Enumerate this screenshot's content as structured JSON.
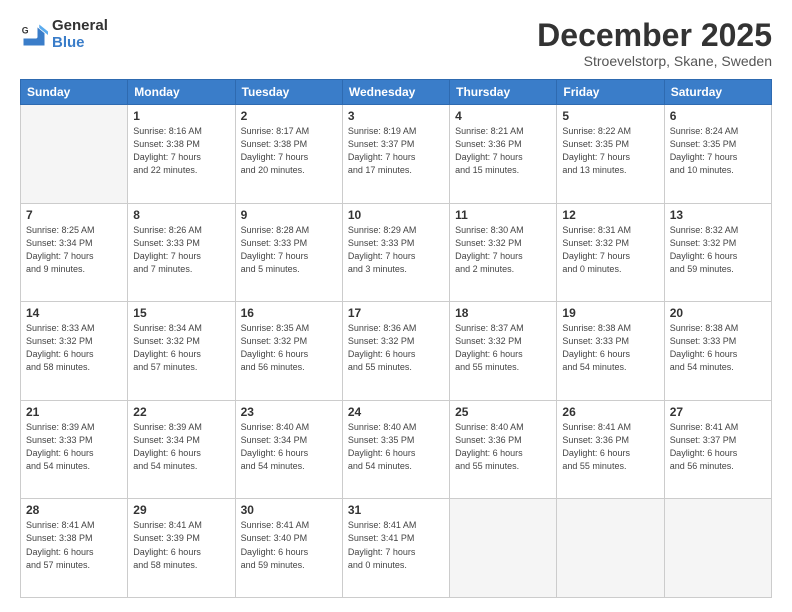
{
  "logo": {
    "general": "General",
    "blue": "Blue"
  },
  "header": {
    "month": "December 2025",
    "location": "Stroevelstorp, Skane, Sweden"
  },
  "weekdays": [
    "Sunday",
    "Monday",
    "Tuesday",
    "Wednesday",
    "Thursday",
    "Friday",
    "Saturday"
  ],
  "weeks": [
    [
      {
        "day": "",
        "info": ""
      },
      {
        "day": "1",
        "info": "Sunrise: 8:16 AM\nSunset: 3:38 PM\nDaylight: 7 hours\nand 22 minutes."
      },
      {
        "day": "2",
        "info": "Sunrise: 8:17 AM\nSunset: 3:38 PM\nDaylight: 7 hours\nand 20 minutes."
      },
      {
        "day": "3",
        "info": "Sunrise: 8:19 AM\nSunset: 3:37 PM\nDaylight: 7 hours\nand 17 minutes."
      },
      {
        "day": "4",
        "info": "Sunrise: 8:21 AM\nSunset: 3:36 PM\nDaylight: 7 hours\nand 15 minutes."
      },
      {
        "day": "5",
        "info": "Sunrise: 8:22 AM\nSunset: 3:35 PM\nDaylight: 7 hours\nand 13 minutes."
      },
      {
        "day": "6",
        "info": "Sunrise: 8:24 AM\nSunset: 3:35 PM\nDaylight: 7 hours\nand 10 minutes."
      }
    ],
    [
      {
        "day": "7",
        "info": "Sunrise: 8:25 AM\nSunset: 3:34 PM\nDaylight: 7 hours\nand 9 minutes."
      },
      {
        "day": "8",
        "info": "Sunrise: 8:26 AM\nSunset: 3:33 PM\nDaylight: 7 hours\nand 7 minutes."
      },
      {
        "day": "9",
        "info": "Sunrise: 8:28 AM\nSunset: 3:33 PM\nDaylight: 7 hours\nand 5 minutes."
      },
      {
        "day": "10",
        "info": "Sunrise: 8:29 AM\nSunset: 3:33 PM\nDaylight: 7 hours\nand 3 minutes."
      },
      {
        "day": "11",
        "info": "Sunrise: 8:30 AM\nSunset: 3:32 PM\nDaylight: 7 hours\nand 2 minutes."
      },
      {
        "day": "12",
        "info": "Sunrise: 8:31 AM\nSunset: 3:32 PM\nDaylight: 7 hours\nand 0 minutes."
      },
      {
        "day": "13",
        "info": "Sunrise: 8:32 AM\nSunset: 3:32 PM\nDaylight: 6 hours\nand 59 minutes."
      }
    ],
    [
      {
        "day": "14",
        "info": "Sunrise: 8:33 AM\nSunset: 3:32 PM\nDaylight: 6 hours\nand 58 minutes."
      },
      {
        "day": "15",
        "info": "Sunrise: 8:34 AM\nSunset: 3:32 PM\nDaylight: 6 hours\nand 57 minutes."
      },
      {
        "day": "16",
        "info": "Sunrise: 8:35 AM\nSunset: 3:32 PM\nDaylight: 6 hours\nand 56 minutes."
      },
      {
        "day": "17",
        "info": "Sunrise: 8:36 AM\nSunset: 3:32 PM\nDaylight: 6 hours\nand 55 minutes."
      },
      {
        "day": "18",
        "info": "Sunrise: 8:37 AM\nSunset: 3:32 PM\nDaylight: 6 hours\nand 55 minutes."
      },
      {
        "day": "19",
        "info": "Sunrise: 8:38 AM\nSunset: 3:33 PM\nDaylight: 6 hours\nand 54 minutes."
      },
      {
        "day": "20",
        "info": "Sunrise: 8:38 AM\nSunset: 3:33 PM\nDaylight: 6 hours\nand 54 minutes."
      }
    ],
    [
      {
        "day": "21",
        "info": "Sunrise: 8:39 AM\nSunset: 3:33 PM\nDaylight: 6 hours\nand 54 minutes."
      },
      {
        "day": "22",
        "info": "Sunrise: 8:39 AM\nSunset: 3:34 PM\nDaylight: 6 hours\nand 54 minutes."
      },
      {
        "day": "23",
        "info": "Sunrise: 8:40 AM\nSunset: 3:34 PM\nDaylight: 6 hours\nand 54 minutes."
      },
      {
        "day": "24",
        "info": "Sunrise: 8:40 AM\nSunset: 3:35 PM\nDaylight: 6 hours\nand 54 minutes."
      },
      {
        "day": "25",
        "info": "Sunrise: 8:40 AM\nSunset: 3:36 PM\nDaylight: 6 hours\nand 55 minutes."
      },
      {
        "day": "26",
        "info": "Sunrise: 8:41 AM\nSunset: 3:36 PM\nDaylight: 6 hours\nand 55 minutes."
      },
      {
        "day": "27",
        "info": "Sunrise: 8:41 AM\nSunset: 3:37 PM\nDaylight: 6 hours\nand 56 minutes."
      }
    ],
    [
      {
        "day": "28",
        "info": "Sunrise: 8:41 AM\nSunset: 3:38 PM\nDaylight: 6 hours\nand 57 minutes."
      },
      {
        "day": "29",
        "info": "Sunrise: 8:41 AM\nSunset: 3:39 PM\nDaylight: 6 hours\nand 58 minutes."
      },
      {
        "day": "30",
        "info": "Sunrise: 8:41 AM\nSunset: 3:40 PM\nDaylight: 6 hours\nand 59 minutes."
      },
      {
        "day": "31",
        "info": "Sunrise: 8:41 AM\nSunset: 3:41 PM\nDaylight: 7 hours\nand 0 minutes."
      },
      {
        "day": "",
        "info": ""
      },
      {
        "day": "",
        "info": ""
      },
      {
        "day": "",
        "info": ""
      }
    ]
  ]
}
